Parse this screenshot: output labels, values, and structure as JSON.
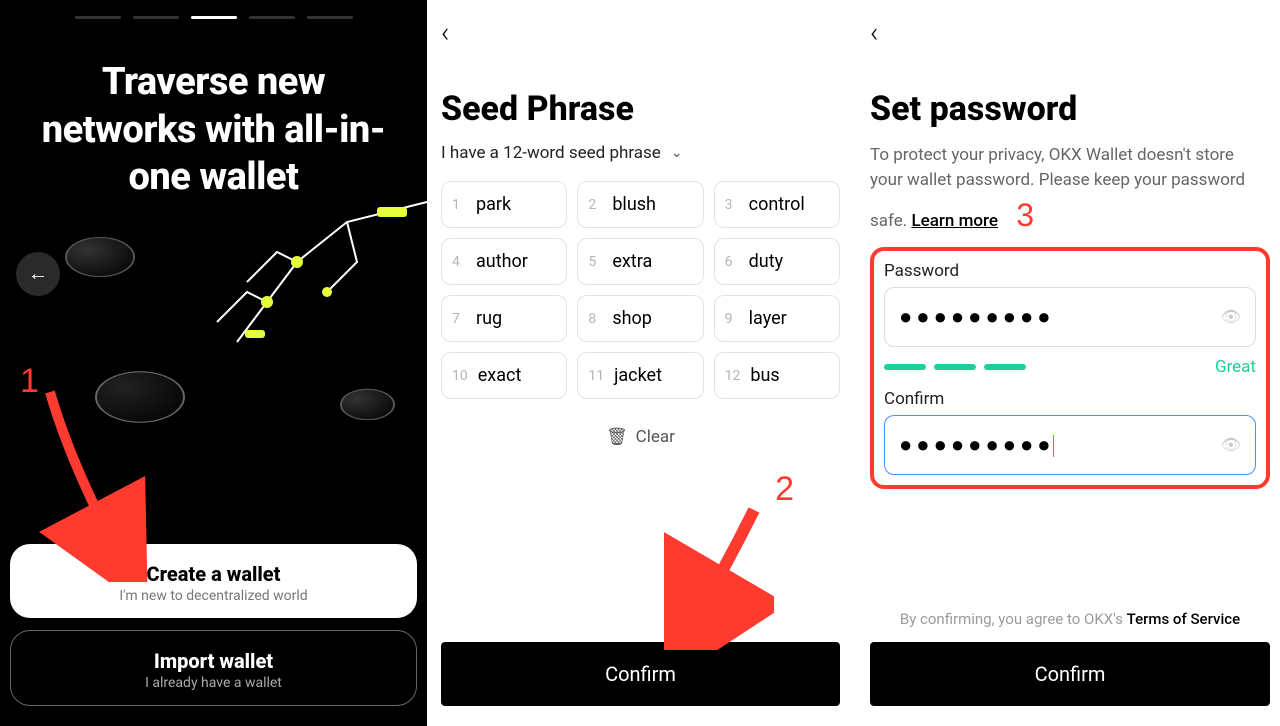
{
  "panel1": {
    "headline": "Traverse new networks with all-in-one wallet",
    "create": {
      "title": "Create a wallet",
      "sub": "I'm new to decentralized world"
    },
    "import": {
      "title": "Import wallet",
      "sub": "I already have a wallet"
    }
  },
  "panel2": {
    "title": "Seed Phrase",
    "selector": "I have a 12-word seed phrase",
    "words": [
      "park",
      "blush",
      "control",
      "author",
      "extra",
      "duty",
      "rug",
      "shop",
      "layer",
      "exact",
      "jacket",
      "bus"
    ],
    "clear": "Clear",
    "confirm": "Confirm"
  },
  "panel3": {
    "title": "Set password",
    "blurb_pre": "To protect your privacy, OKX Wallet doesn't store your wallet password. Please keep your password safe.  ",
    "learn_more": "Learn more",
    "password_label": "Password",
    "confirm_label": "Confirm",
    "password_mask": "●●●●●●●●●",
    "confirm_mask": "●●●●●●●●●",
    "strength": "Great",
    "tos_pre": "By confirming, you agree to OKX's ",
    "tos_link": "Terms of Service",
    "confirm_btn": "Confirm"
  },
  "annotations": {
    "n1": "1",
    "n2": "2",
    "n3": "3"
  }
}
